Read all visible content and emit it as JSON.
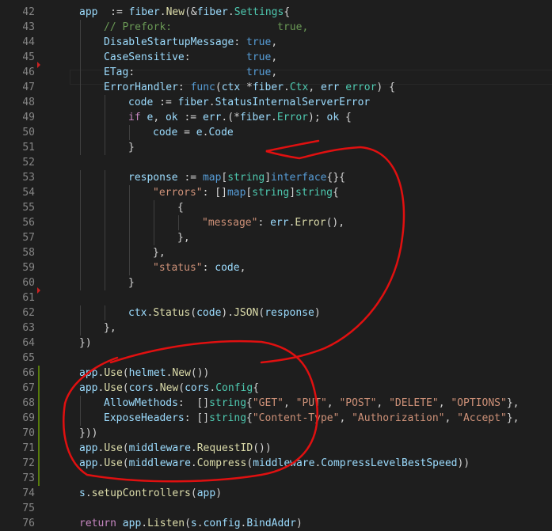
{
  "editor": {
    "lines": [
      {
        "n": "42",
        "indent": 1,
        "segs": [
          [
            "var",
            "app"
          ],
          [
            "",
            "  := "
          ],
          [
            "var",
            "fiber"
          ],
          [
            "",
            "."
          ],
          [
            "fn",
            "New"
          ],
          [
            "",
            "(&"
          ],
          [
            "var",
            "fiber"
          ],
          [
            "",
            "."
          ],
          [
            "typ",
            "Settings"
          ],
          [
            "",
            "{"
          ]
        ]
      },
      {
        "n": "43",
        "indent": 2,
        "segs": [
          [
            "cm",
            "// Prefork:                 true,"
          ]
        ]
      },
      {
        "n": "44",
        "indent": 2,
        "segs": [
          [
            "var",
            "DisableStartupMessage"
          ],
          [
            "",
            ": "
          ],
          [
            "kw",
            "true"
          ],
          [
            "",
            ","
          ]
        ]
      },
      {
        "n": "45",
        "indent": 2,
        "segs": [
          [
            "var",
            "CaseSensitive"
          ],
          [
            "",
            ":         "
          ],
          [
            "kw",
            "true"
          ],
          [
            "",
            ","
          ]
        ]
      },
      {
        "n": "46",
        "indent": 2,
        "segs": [
          [
            "var",
            "ETag"
          ],
          [
            "",
            ":                  "
          ],
          [
            "kw",
            "true"
          ],
          [
            "",
            ","
          ]
        ]
      },
      {
        "n": "47",
        "indent": 2,
        "segs": [
          [
            "var",
            "ErrorHandler"
          ],
          [
            "",
            ": "
          ],
          [
            "kw",
            "func"
          ],
          [
            "",
            "("
          ],
          [
            "var",
            "ctx"
          ],
          [
            "",
            " *"
          ],
          [
            "var",
            "fiber"
          ],
          [
            "",
            "."
          ],
          [
            "typ",
            "Ctx"
          ],
          [
            "",
            ", "
          ],
          [
            "var",
            "err"
          ],
          [
            "",
            " "
          ],
          [
            "typ",
            "error"
          ],
          [
            "",
            ") {"
          ]
        ]
      },
      {
        "n": "48",
        "indent": 3,
        "segs": [
          [
            "var",
            "code"
          ],
          [
            "",
            " := "
          ],
          [
            "var",
            "fiber"
          ],
          [
            "",
            "."
          ],
          [
            "var",
            "StatusInternalServerError"
          ]
        ]
      },
      {
        "n": "49",
        "indent": 3,
        "segs": [
          [
            "ctrl",
            "if"
          ],
          [
            "",
            " "
          ],
          [
            "var",
            "e"
          ],
          [
            "",
            ", "
          ],
          [
            "var",
            "ok"
          ],
          [
            "",
            " := "
          ],
          [
            "var",
            "err"
          ],
          [
            "",
            ".(*"
          ],
          [
            "var",
            "fiber"
          ],
          [
            "",
            "."
          ],
          [
            "typ",
            "Error"
          ],
          [
            "",
            "); "
          ],
          [
            "var",
            "ok"
          ],
          [
            "",
            " {"
          ]
        ]
      },
      {
        "n": "50",
        "indent": 4,
        "segs": [
          [
            "var",
            "code"
          ],
          [
            "",
            " = "
          ],
          [
            "var",
            "e"
          ],
          [
            "",
            "."
          ],
          [
            "var",
            "Code"
          ]
        ]
      },
      {
        "n": "51",
        "indent": 3,
        "segs": [
          [
            "",
            "}"
          ]
        ]
      },
      {
        "n": "52",
        "indent": 0,
        "segs": []
      },
      {
        "n": "53",
        "indent": 3,
        "segs": [
          [
            "var",
            "response"
          ],
          [
            "",
            " := "
          ],
          [
            "kw",
            "map"
          ],
          [
            "",
            "["
          ],
          [
            "typ",
            "string"
          ],
          [
            "",
            "]"
          ],
          [
            "kw",
            "interface"
          ],
          [
            "",
            "{}{"
          ]
        ]
      },
      {
        "n": "54",
        "indent": 4,
        "segs": [
          [
            "str",
            "\"errors\""
          ],
          [
            "",
            ": []"
          ],
          [
            "kw",
            "map"
          ],
          [
            "",
            "["
          ],
          [
            "typ",
            "string"
          ],
          [
            "",
            "]"
          ],
          [
            "typ",
            "string"
          ],
          [
            "",
            "{"
          ]
        ]
      },
      {
        "n": "55",
        "indent": 5,
        "segs": [
          [
            "",
            "{"
          ]
        ]
      },
      {
        "n": "56",
        "indent": 6,
        "segs": [
          [
            "str",
            "\"message\""
          ],
          [
            "",
            ": "
          ],
          [
            "var",
            "err"
          ],
          [
            "",
            "."
          ],
          [
            "fn",
            "Error"
          ],
          [
            "",
            "(),"
          ]
        ]
      },
      {
        "n": "57",
        "indent": 5,
        "segs": [
          [
            "",
            "},"
          ]
        ]
      },
      {
        "n": "58",
        "indent": 4,
        "segs": [
          [
            "",
            "},"
          ]
        ]
      },
      {
        "n": "59",
        "indent": 4,
        "segs": [
          [
            "str",
            "\"status\""
          ],
          [
            "",
            ": "
          ],
          [
            "var",
            "code"
          ],
          [
            "",
            ","
          ]
        ]
      },
      {
        "n": "60",
        "indent": 3,
        "segs": [
          [
            "",
            "}"
          ]
        ]
      },
      {
        "n": "61",
        "indent": 0,
        "segs": []
      },
      {
        "n": "62",
        "indent": 3,
        "segs": [
          [
            "var",
            "ctx"
          ],
          [
            "",
            "."
          ],
          [
            "fn",
            "Status"
          ],
          [
            "",
            "("
          ],
          [
            "var",
            "code"
          ],
          [
            "",
            ")."
          ],
          [
            "fn",
            "JSON"
          ],
          [
            "",
            "("
          ],
          [
            "var",
            "response"
          ],
          [
            "",
            ")"
          ]
        ]
      },
      {
        "n": "63",
        "indent": 2,
        "segs": [
          [
            "",
            "},"
          ]
        ]
      },
      {
        "n": "64",
        "indent": 1,
        "segs": [
          [
            "",
            "})"
          ]
        ]
      },
      {
        "n": "65",
        "indent": 0,
        "segs": []
      },
      {
        "n": "66",
        "indent": 1,
        "segs": [
          [
            "var",
            "app"
          ],
          [
            "",
            "."
          ],
          [
            "fn",
            "Use"
          ],
          [
            "",
            "("
          ],
          [
            "var",
            "helmet"
          ],
          [
            "",
            "."
          ],
          [
            "fn",
            "New"
          ],
          [
            "",
            "())"
          ]
        ]
      },
      {
        "n": "67",
        "indent": 1,
        "segs": [
          [
            "var",
            "app"
          ],
          [
            "",
            "."
          ],
          [
            "fn",
            "Use"
          ],
          [
            "",
            "("
          ],
          [
            "var",
            "cors"
          ],
          [
            "",
            "."
          ],
          [
            "fn",
            "New"
          ],
          [
            "",
            "("
          ],
          [
            "var",
            "cors"
          ],
          [
            "",
            "."
          ],
          [
            "typ",
            "Config"
          ],
          [
            "",
            "{"
          ]
        ]
      },
      {
        "n": "68",
        "indent": 2,
        "segs": [
          [
            "var",
            "AllowMethods"
          ],
          [
            "",
            ":  []"
          ],
          [
            "typ",
            "string"
          ],
          [
            "",
            "{"
          ],
          [
            "str",
            "\"GET\""
          ],
          [
            "",
            ", "
          ],
          [
            "str",
            "\"PUT\""
          ],
          [
            "",
            ", "
          ],
          [
            "str",
            "\"POST\""
          ],
          [
            "",
            ", "
          ],
          [
            "str",
            "\"DELETE\""
          ],
          [
            "",
            ", "
          ],
          [
            "str",
            "\"OPTIONS\""
          ],
          [
            "",
            "},"
          ]
        ]
      },
      {
        "n": "69",
        "indent": 2,
        "segs": [
          [
            "var",
            "ExposeHeaders"
          ],
          [
            "",
            ": []"
          ],
          [
            "typ",
            "string"
          ],
          [
            "",
            "{"
          ],
          [
            "str",
            "\"Content-Type\""
          ],
          [
            "",
            ", "
          ],
          [
            "str",
            "\"Authorization\""
          ],
          [
            "",
            ", "
          ],
          [
            "str",
            "\"Accept\""
          ],
          [
            "",
            "},"
          ]
        ]
      },
      {
        "n": "70",
        "indent": 1,
        "segs": [
          [
            "",
            "}))"
          ]
        ]
      },
      {
        "n": "71",
        "indent": 1,
        "segs": [
          [
            "var",
            "app"
          ],
          [
            "",
            "."
          ],
          [
            "fn",
            "Use"
          ],
          [
            "",
            "("
          ],
          [
            "var",
            "middleware"
          ],
          [
            "",
            "."
          ],
          [
            "fn",
            "RequestID"
          ],
          [
            "",
            "())"
          ]
        ]
      },
      {
        "n": "72",
        "indent": 1,
        "segs": [
          [
            "var",
            "app"
          ],
          [
            "",
            "."
          ],
          [
            "fn",
            "Use"
          ],
          [
            "",
            "("
          ],
          [
            "var",
            "middleware"
          ],
          [
            "",
            "."
          ],
          [
            "fn",
            "Compress"
          ],
          [
            "",
            "("
          ],
          [
            "var",
            "middleware"
          ],
          [
            "",
            "."
          ],
          [
            "var",
            "CompressLevelBestSpeed"
          ],
          [
            "",
            "))"
          ]
        ]
      },
      {
        "n": "73",
        "indent": 0,
        "segs": []
      },
      {
        "n": "74",
        "indent": 1,
        "segs": [
          [
            "var",
            "s"
          ],
          [
            "",
            "."
          ],
          [
            "fn",
            "setupControllers"
          ],
          [
            "",
            "("
          ],
          [
            "var",
            "app"
          ],
          [
            "",
            ")"
          ]
        ]
      },
      {
        "n": "75",
        "indent": 0,
        "segs": []
      },
      {
        "n": "76",
        "indent": 1,
        "segs": [
          [
            "ctrl",
            "return"
          ],
          [
            "",
            " "
          ],
          [
            "var",
            "app"
          ],
          [
            "",
            "."
          ],
          [
            "fn",
            "Listen"
          ],
          [
            "",
            "("
          ],
          [
            "var",
            "s"
          ],
          [
            "",
            "."
          ],
          [
            "var",
            "config"
          ],
          [
            "",
            "."
          ],
          [
            "var",
            "BindAddr"
          ],
          [
            "",
            ")"
          ]
        ]
      }
    ],
    "modified_lines": [
      "66",
      "67",
      "68",
      "69",
      "70",
      "71",
      "72",
      "73"
    ],
    "breakpoint_markers": [
      "46",
      "61"
    ],
    "colors": {
      "background": "#1e1e1e",
      "annotation": "#e01010",
      "modified": "#587c0c"
    }
  }
}
